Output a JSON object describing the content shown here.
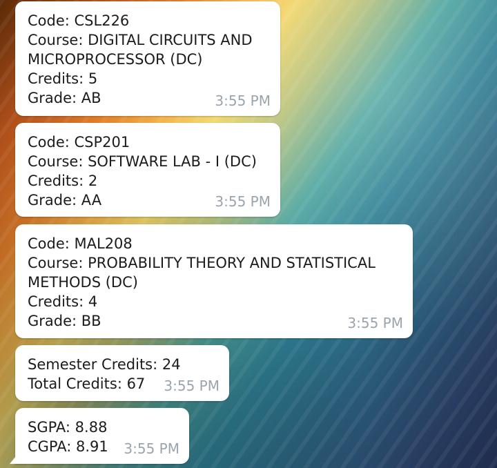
{
  "messages": [
    {
      "lines": [
        "Code: CSL226",
        "Course: DIGITAL CIRCUITS AND",
        "MICROPROCESSOR (DC)",
        "Credits: 5",
        "Grade: AB"
      ],
      "time": "3:55 PM"
    },
    {
      "lines": [
        "Code: CSP201",
        "Course: SOFTWARE LAB - I (DC)",
        "Credits: 2",
        "Grade: AA"
      ],
      "time": "3:55 PM"
    },
    {
      "lines": [
        "Code: MAL208",
        "Course: PROBABILITY THEORY AND STATISTICAL",
        "METHODS (DC)",
        "Credits: 4",
        "Grade: BB"
      ],
      "time": "3:55 PM"
    },
    {
      "lines": [
        "Semester Credits: 24",
        "Total Credits: 67"
      ],
      "time": "3:55 PM"
    },
    {
      "lines": [
        "SGPA: 8.88",
        "CGPA: 8.91"
      ],
      "time": "3:55 PM"
    }
  ]
}
